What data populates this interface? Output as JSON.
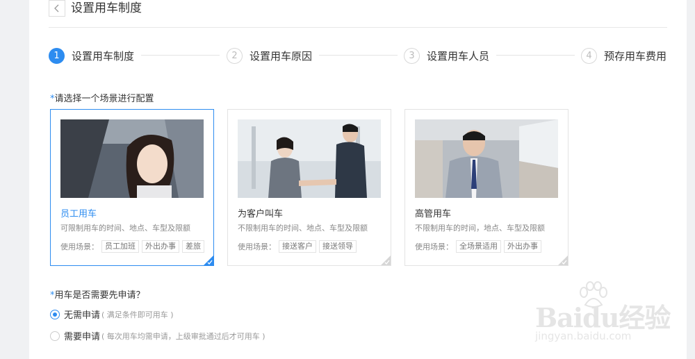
{
  "header": {
    "title": "设置用车制度"
  },
  "steps": [
    {
      "num": "1",
      "label": "设置用车制度"
    },
    {
      "num": "2",
      "label": "设置用车原因"
    },
    {
      "num": "3",
      "label": "设置用车人员"
    },
    {
      "num": "4",
      "label": "预存用车费用"
    }
  ],
  "scenario": {
    "required_mark": "*",
    "label": "请选择一个场景进行配置",
    "cards": [
      {
        "title": "员工用车",
        "desc": "可限制用车的时间、地点、车型及限额",
        "tag_label": "使用场景：",
        "tags": [
          "员工加班",
          "外出办事",
          "差旅"
        ]
      },
      {
        "title": "为客户叫车",
        "desc": "不限制用车的时间、地点、车型及限额",
        "tag_label": "使用场景：",
        "tags": [
          "接送客户",
          "接送领导"
        ]
      },
      {
        "title": "高管用车",
        "desc": "不限制用车的时间，地点、车型及限额",
        "tag_label": "使用场景：",
        "tags": [
          "全场景适用",
          "外出办事"
        ]
      }
    ]
  },
  "apply": {
    "required_mark": "*",
    "label": "用车是否需要先申请？",
    "options": [
      {
        "label": "无需申请",
        "hint": "( 满足条件即可用车 )"
      },
      {
        "label": "需要申请",
        "hint": "( 每次用车均需申请，上级审批通过后才可用车 )"
      }
    ]
  },
  "watermark": {
    "logo": "Baidu经验",
    "sub": "jingyan.baidu.com"
  },
  "colors": {
    "accent": "#2d8cf0",
    "border": "#e3e3e3",
    "muted": "#888888"
  }
}
